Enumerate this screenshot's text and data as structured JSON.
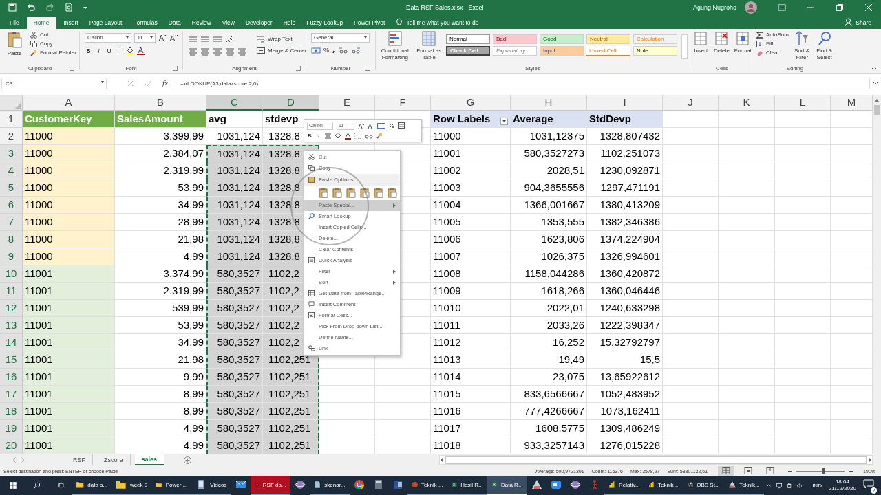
{
  "window": {
    "title": "Data RSF Sales.xlsx  -  Excel",
    "user": "Agung Nugroho"
  },
  "menu_tabs": [
    {
      "label": "File",
      "selected": false
    },
    {
      "label": "Home",
      "selected": true
    },
    {
      "label": "Insert",
      "selected": false
    },
    {
      "label": "Page Layout",
      "selected": false
    },
    {
      "label": "Formulas",
      "selected": false
    },
    {
      "label": "Data",
      "selected": false
    },
    {
      "label": "Review",
      "selected": false
    },
    {
      "label": "View",
      "selected": false
    },
    {
      "label": "Developer",
      "selected": false
    },
    {
      "label": "Help",
      "selected": false
    },
    {
      "label": "Fuzzy Lookup",
      "selected": false
    },
    {
      "label": "Power Pivot",
      "selected": false
    }
  ],
  "tell_me": "Tell me what you want to do",
  "share": "Share",
  "ribbon": {
    "clipboard": {
      "label": "Clipboard",
      "paste": "Paste",
      "items": [
        "Cut",
        "Copy",
        "Format Painter"
      ]
    },
    "font": {
      "label": "Font",
      "name": "Calibri",
      "size": "11",
      "buttons": [
        "B",
        "I",
        "U"
      ]
    },
    "alignment": {
      "label": "Alignment",
      "wrap": "Wrap Text",
      "merge": "Merge & Center"
    },
    "number": {
      "label": "Number",
      "format": "General",
      "percent": "%"
    },
    "styles": {
      "label": "Styles",
      "conditional": "Conditional Formatting",
      "format_table": "Format as Table",
      "cells": [
        {
          "label": "Normal",
          "color": "#ffffff"
        },
        {
          "label": "Bad",
          "color": "#ffc7ce"
        },
        {
          "label": "Good",
          "color": "#c6efce"
        },
        {
          "label": "Neutral",
          "color": "#ffeb9c"
        },
        {
          "label": "Calculation",
          "color": "#f2f2f2"
        },
        {
          "label": "Check Cell",
          "color": "#a5a5a5"
        },
        {
          "label": "Explanatory ...",
          "color": "#ffffff"
        },
        {
          "label": "Input",
          "color": "#ffcc99"
        },
        {
          "label": "Linked Cell",
          "color": "#ffffff"
        },
        {
          "label": "Note",
          "color": "#ffffcc"
        }
      ]
    },
    "cells": {
      "label": "Cells",
      "buttons": [
        "Insert",
        "Delete",
        "Format"
      ]
    },
    "editing": {
      "label": "Editing",
      "items": [
        "AutoSum",
        "Fill",
        "Clear"
      ],
      "buttons": [
        "Sort & Filter",
        "Find & Select"
      ]
    }
  },
  "formula_bar": {
    "name_box": "C3",
    "fx": "fx",
    "formula": "=VLOOKUP(A3;datazscore;2;0)"
  },
  "columns": [
    {
      "letter": "A",
      "selected": false
    },
    {
      "letter": "B",
      "selected": false
    },
    {
      "letter": "C",
      "selected": true
    },
    {
      "letter": "D",
      "selected": true
    },
    {
      "letter": "E",
      "selected": false
    },
    {
      "letter": "F",
      "selected": false
    },
    {
      "letter": "G",
      "selected": false
    },
    {
      "letter": "H",
      "selected": false
    },
    {
      "letter": "I",
      "selected": false
    },
    {
      "letter": "J",
      "selected": false
    },
    {
      "letter": "K",
      "selected": false
    },
    {
      "letter": "L",
      "selected": false
    },
    {
      "letter": "M",
      "selected": false
    }
  ],
  "rows": [
    {
      "n": "1",
      "kind": "header",
      "selected": false,
      "cells": {
        "A": {
          "text": "CustomerKey",
          "color": "#70ad47"
        },
        "B": {
          "text": "SalesAmount",
          "color": "#70ad47"
        },
        "C": "avg",
        "D": "stdevp",
        "G": {
          "text": "Row Labels",
          "color": "#d9e1f2",
          "filter": true
        },
        "H": {
          "text": "Average",
          "color": "#d9e1f2"
        },
        "I": {
          "text": "StdDevp",
          "color": "#d9e1f2"
        }
      }
    },
    {
      "n": "2",
      "kind": "data",
      "selected": false,
      "cells": {
        "A": {
          "text": "11000",
          "color": "#fff2cc"
        },
        "B": "3.399,99",
        "C": "1031,124",
        "D": "1328,8",
        "G": "11000",
        "H": "1031,12375",
        "I": "1328,807432"
      }
    },
    {
      "n": "3",
      "kind": "data",
      "selected": true,
      "cells": {
        "A": {
          "text": "11000",
          "color": "#fff2cc"
        },
        "B": "2.384,07",
        "C": "1031,124",
        "D": "1328,8",
        "G": "11001",
        "H": "580,3527273",
        "I": "1102,251073"
      }
    },
    {
      "n": "4",
      "kind": "data",
      "selected": true,
      "cells": {
        "A": {
          "text": "11000",
          "color": "#fff2cc"
        },
        "B": "2.319,99",
        "C": "1031,124",
        "D": "1328,8",
        "G": "11002",
        "H": "2028,51",
        "I": "1230,092871"
      }
    },
    {
      "n": "5",
      "kind": "data",
      "selected": true,
      "cells": {
        "A": {
          "text": "11000",
          "color": "#fff2cc"
        },
        "B": "53,99",
        "C": "1031,124",
        "D": "1328,8",
        "G": "11003",
        "H": "904,3655556",
        "I": "1297,471191"
      }
    },
    {
      "n": "6",
      "kind": "data",
      "selected": true,
      "cells": {
        "A": {
          "text": "11000",
          "color": "#fff2cc"
        },
        "B": "34,99",
        "C": "1031,124",
        "D": "1328,8",
        "G": "11004",
        "H": "1366,001667",
        "I": "1380,413209"
      }
    },
    {
      "n": "7",
      "kind": "data",
      "selected": true,
      "cells": {
        "A": {
          "text": "11000",
          "color": "#fff2cc"
        },
        "B": "28,99",
        "C": "1031,124",
        "D": "1328,8",
        "G": "11005",
        "H": "1353,555",
        "I": "1382,346386"
      }
    },
    {
      "n": "8",
      "kind": "data",
      "selected": true,
      "cells": {
        "A": {
          "text": "11000",
          "color": "#fff2cc"
        },
        "B": "21,98",
        "C": "1031,124",
        "D": "1328,8",
        "G": "11006",
        "H": "1623,806",
        "I": "1374,224904"
      }
    },
    {
      "n": "9",
      "kind": "data",
      "selected": true,
      "cells": {
        "A": {
          "text": "11000",
          "color": "#fff2cc"
        },
        "B": "4,99",
        "C": "1031,124",
        "D": "1328,8",
        "G": "11007",
        "H": "1026,375",
        "I": "1326,994601"
      }
    },
    {
      "n": "10",
      "kind": "data",
      "selected": true,
      "cells": {
        "A": {
          "text": "11001",
          "color": "#e2efda"
        },
        "B": "3.374,99",
        "C": "580,3527",
        "D": "1102,2",
        "G": "11008",
        "H": "1158,044286",
        "I": "1360,420872"
      }
    },
    {
      "n": "11",
      "kind": "data",
      "selected": true,
      "cells": {
        "A": {
          "text": "11001",
          "color": "#e2efda"
        },
        "B": "2.319,99",
        "C": "580,3527",
        "D": "1102,2",
        "G": "11009",
        "H": "1618,266",
        "I": "1360,046446"
      }
    },
    {
      "n": "12",
      "kind": "data",
      "selected": true,
      "cells": {
        "A": {
          "text": "11001",
          "color": "#e2efda"
        },
        "B": "539,99",
        "C": "580,3527",
        "D": "1102,2",
        "G": "11010",
        "H": "2022,01",
        "I": "1240,633298"
      }
    },
    {
      "n": "13",
      "kind": "data",
      "selected": true,
      "cells": {
        "A": {
          "text": "11001",
          "color": "#e2efda"
        },
        "B": "53,99",
        "C": "580,3527",
        "D": "1102,2",
        "G": "11011",
        "H": "2033,26",
        "I": "1222,398347"
      }
    },
    {
      "n": "14",
      "kind": "data",
      "selected": true,
      "cells": {
        "A": {
          "text": "11001",
          "color": "#e2efda"
        },
        "B": "34,99",
        "C": "580,3527",
        "D": "1102,2",
        "G": "11012",
        "H": "16,252",
        "I": "15,32792797"
      }
    },
    {
      "n": "15",
      "kind": "data",
      "selected": true,
      "cells": {
        "A": {
          "text": "11001",
          "color": "#e2efda"
        },
        "B": "21,98",
        "C": "580,3527",
        "D": "1102,251",
        "G": "11013",
        "H": "19,49",
        "I": "15,5"
      }
    },
    {
      "n": "16",
      "kind": "data",
      "selected": true,
      "cells": {
        "A": {
          "text": "11001",
          "color": "#e2efda"
        },
        "B": "9,99",
        "C": "580,3527",
        "D": "1102,251",
        "G": "11014",
        "H": "23,075",
        "I": "13,65922612"
      }
    },
    {
      "n": "17",
      "kind": "data",
      "selected": true,
      "cells": {
        "A": {
          "text": "11001",
          "color": "#e2efda"
        },
        "B": "8,99",
        "C": "580,3527",
        "D": "1102,251",
        "G": "11015",
        "H": "833,6566667",
        "I": "1052,483952"
      }
    },
    {
      "n": "18",
      "kind": "data",
      "selected": true,
      "cells": {
        "A": {
          "text": "11001",
          "color": "#e2efda"
        },
        "B": "8,99",
        "C": "580,3527",
        "D": "1102,251",
        "G": "11016",
        "H": "777,4266667",
        "I": "1073,162411"
      }
    },
    {
      "n": "19",
      "kind": "data",
      "selected": true,
      "cells": {
        "A": {
          "text": "11001",
          "color": "#e2efda"
        },
        "B": "4,99",
        "C": "580,3527",
        "D": "1102,251",
        "G": "11017",
        "H": "1608,5775",
        "I": "1309,486249"
      }
    },
    {
      "n": "20",
      "kind": "data",
      "selected": true,
      "cells": {
        "A": {
          "text": "11001",
          "color": "#e2efda"
        },
        "B": "4,99",
        "C": "580,3527",
        "D": "1102,251",
        "G": "11018",
        "H": "933,3257143",
        "I": "1276,015228"
      }
    }
  ],
  "mini_toolbar": {
    "font": "Calibri",
    "size": "11",
    "buttons": [
      "B",
      "I"
    ]
  },
  "context_menu": {
    "items": [
      {
        "kind": "item",
        "label": "Cut",
        "selected": false,
        "submenu": false
      },
      {
        "kind": "item",
        "label": "Copy",
        "selected": false,
        "submenu": false
      },
      {
        "kind": "header",
        "label": "Paste Options:"
      },
      {
        "kind": "paste-icons"
      },
      {
        "kind": "item",
        "label": "Paste Special...",
        "selected": true,
        "submenu": true
      },
      {
        "kind": "item",
        "label": "Smart Lookup",
        "selected": false,
        "submenu": false
      },
      {
        "kind": "item",
        "label": "Insert Copied Cells...",
        "selected": false,
        "submenu": false
      },
      {
        "kind": "item",
        "label": "Delete...",
        "selected": false,
        "submenu": false
      },
      {
        "kind": "item",
        "label": "Clear Contents",
        "selected": false,
        "submenu": false
      },
      {
        "kind": "item",
        "label": "Quick Analysis",
        "selected": false,
        "submenu": false
      },
      {
        "kind": "item",
        "label": "Filter",
        "selected": false,
        "submenu": true
      },
      {
        "kind": "item",
        "label": "Sort",
        "selected": false,
        "submenu": true
      },
      {
        "kind": "item",
        "label": "Get Data from Table/Range...",
        "selected": false,
        "submenu": false
      },
      {
        "kind": "item",
        "label": "Insert Comment",
        "selected": false,
        "submenu": false
      },
      {
        "kind": "item",
        "label": "Format Cells...",
        "selected": false,
        "submenu": false
      },
      {
        "kind": "item",
        "label": "Pick From Drop-down List...",
        "selected": false,
        "submenu": false
      },
      {
        "kind": "item",
        "label": "Define Name...",
        "selected": false,
        "submenu": false
      },
      {
        "kind": "item",
        "label": "Link",
        "selected": false,
        "submenu": false
      }
    ]
  },
  "sheet_tabs": [
    {
      "label": "RSF",
      "selected": false
    },
    {
      "label": "Zscore",
      "selected": false
    },
    {
      "label": "sales",
      "selected": true
    }
  ],
  "status_bar": {
    "message": "Select destination and press ENTER or choose Paste",
    "stats": [
      "Average: 500,9721301",
      "Count: 116376",
      "Max: 3578,27",
      "Sum: 58301132,61"
    ],
    "zoom": "190%",
    "zoom_slider": {
      "level": 0.55
    }
  },
  "taskbar": {
    "items": [
      {
        "kind": "folder",
        "label": "data a...",
        "selected": false,
        "flashing": false
      },
      {
        "kind": "folder",
        "label": "week 9",
        "selected": false,
        "flashing": false
      },
      {
        "kind": "folder",
        "label": "Power ...",
        "selected": false,
        "flashing": false
      },
      {
        "kind": "phone",
        "label": "Videos",
        "selected": false,
        "flashing": false
      },
      {
        "kind": "mail",
        "selected": false,
        "flashing": false
      },
      {
        "kind": "ring",
        "label": "RSF da...",
        "selected": false,
        "flashing": true
      },
      {
        "kind": "globe",
        "selected": false,
        "flashing": false
      },
      {
        "kind": "document",
        "label": "skenar...",
        "selected": false,
        "flashing": false
      },
      {
        "kind": "browser",
        "selected": false,
        "flashing": false
      },
      {
        "kind": "calculator",
        "selected": false,
        "flashing": false
      },
      {
        "kind": "word",
        "selected": false,
        "flashing": false
      },
      {
        "kind": "powerpoint",
        "label": "Teknik ...",
        "selected": false,
        "flashing": false
      },
      {
        "kind": "excel",
        "label": "Hasil R...",
        "selected": false,
        "flashing": false
      },
      {
        "kind": "excel",
        "label": "Data R...",
        "selected": true,
        "flashing": false
      },
      {
        "kind": "triangle",
        "selected": false,
        "flashing": false
      },
      {
        "kind": "camera",
        "selected": false,
        "flashing": false
      },
      {
        "kind": "globe",
        "selected": false,
        "flashing": false
      },
      {
        "kind": "figure",
        "selected": false,
        "flashing": false
      },
      {
        "kind": "bars",
        "label": "Relativ...",
        "selected": false,
        "flashing": false
      },
      {
        "kind": "bars",
        "label": "Teknik ...",
        "selected": false,
        "flashing": false
      },
      {
        "kind": "record",
        "label": "OBS St...",
        "selected": false,
        "flashing": false
      },
      {
        "kind": "triangle",
        "label": "Teknik...",
        "selected": false,
        "flashing": false
      }
    ],
    "language": "IND",
    "time": "18:04",
    "date": "21/12/2020",
    "notifications": "2"
  }
}
